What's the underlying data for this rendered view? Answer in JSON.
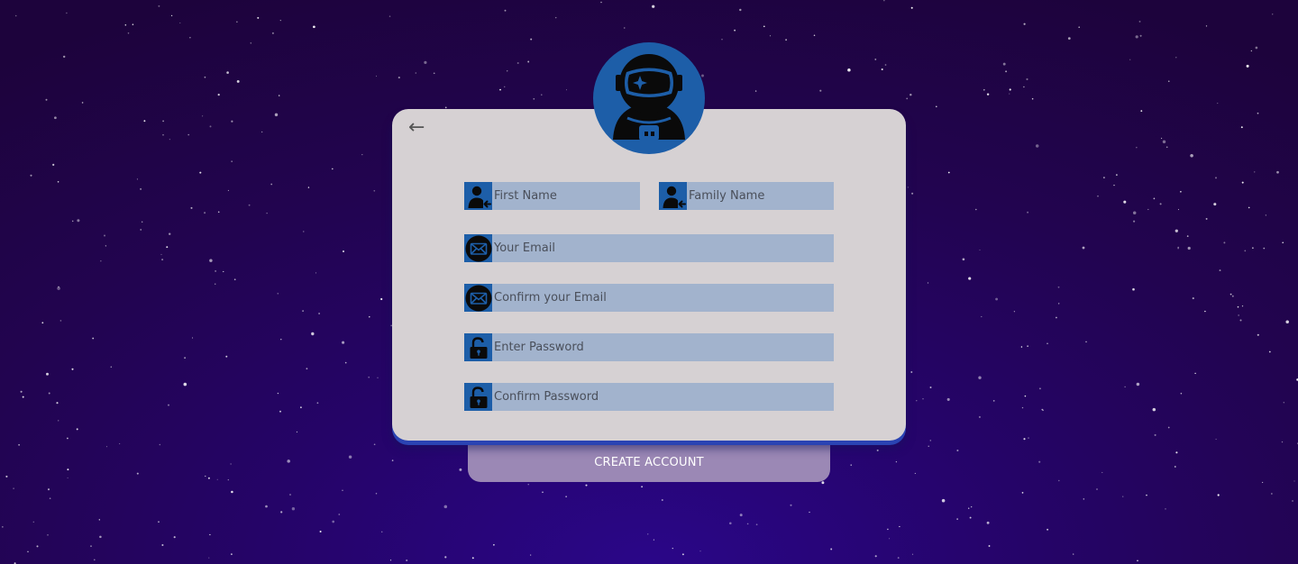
{
  "colors": {
    "background": "#220450",
    "card": "#d6d1d3",
    "accent": "#1d5ea8",
    "field": "#a2b3cd",
    "submit": "#9b88b5"
  },
  "header": {
    "back_label": "←",
    "avatar_icon": "astronaut-icon"
  },
  "form": {
    "first_name": {
      "placeholder": "First Name",
      "icon": "user-icon"
    },
    "family_name": {
      "placeholder": "Family Name",
      "icon": "user-icon"
    },
    "email": {
      "placeholder": "Your Email",
      "icon": "mail-icon"
    },
    "confirm_email": {
      "placeholder": "Confirm your Email",
      "icon": "mail-icon"
    },
    "password": {
      "placeholder": "Enter Password",
      "icon": "lock-icon"
    },
    "confirm_password": {
      "placeholder": "Confirm Password",
      "icon": "lock-icon"
    },
    "submit_label": "CREATE ACCOUNT"
  }
}
